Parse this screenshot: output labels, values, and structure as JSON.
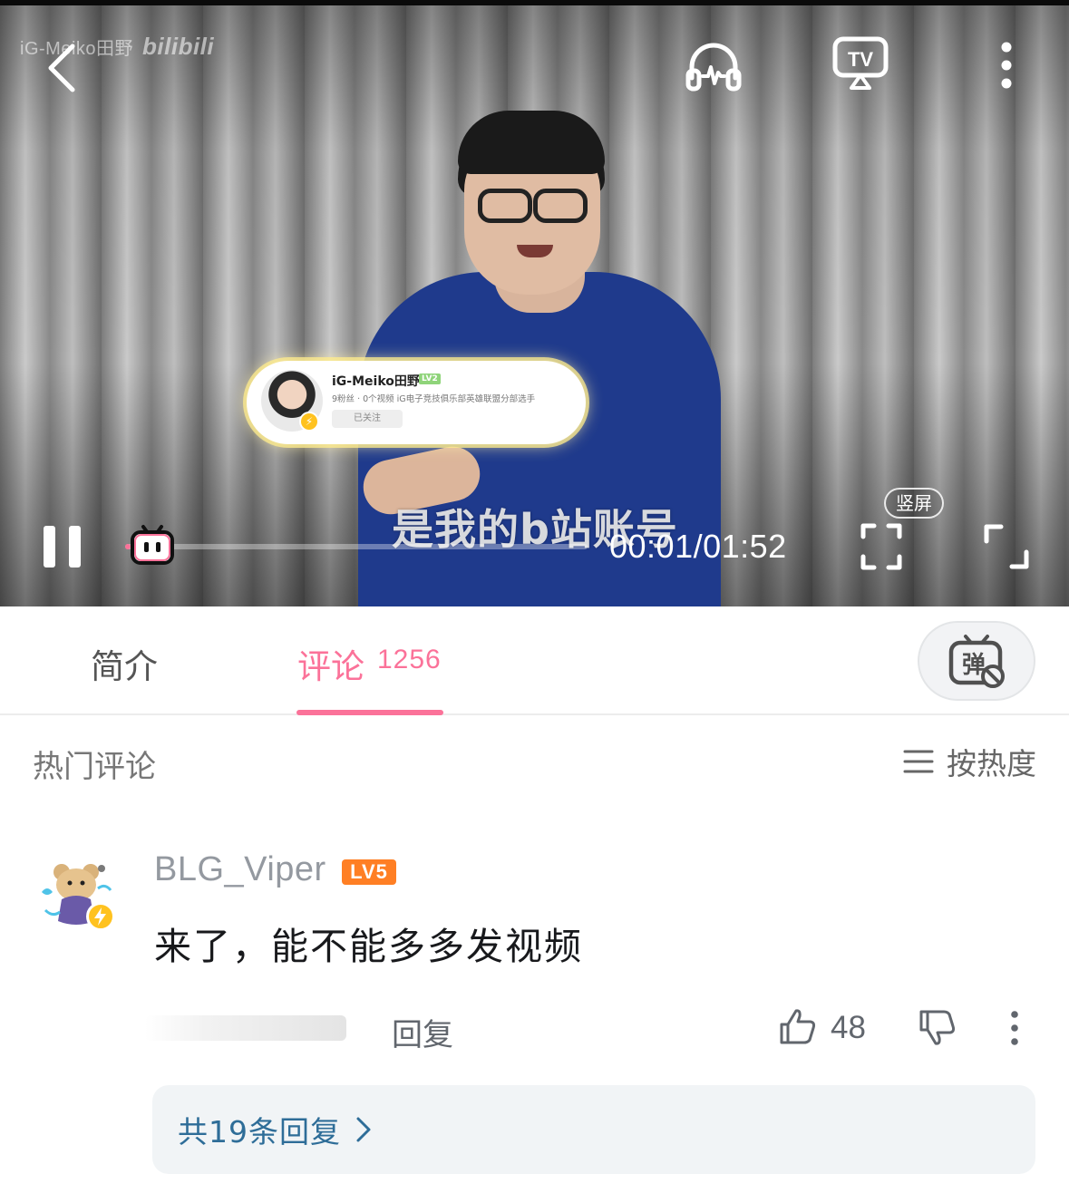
{
  "player": {
    "watermark_channel": "iG-Meiko田野",
    "watermark_brand": "bilibili",
    "subtitle": "是我的b站账号",
    "time_display": "00:01/01:52",
    "portrait_badge": "竖屏",
    "progress_fraction": 0.009,
    "accent_color": "#fb7299",
    "icons": [
      "back-icon",
      "headphones-icon",
      "tv-cast-icon",
      "more-vertical-icon",
      "pause-icon",
      "bilibili-tv-knob-icon",
      "portrait-screen-icon",
      "fullscreen-icon"
    ]
  },
  "profile_card": {
    "name": "iG-Meiko田野",
    "level": "LV2",
    "description": "9粉丝 · 0个视频  iG电子竞技俱乐部英雄联盟分部选手",
    "follow_label": "已关注"
  },
  "tabs": {
    "intro_label": "简介",
    "comments_label": "评论",
    "comments_count": "1256",
    "danmaku_icon": "danmaku-off-icon"
  },
  "comments": {
    "section_title": "热门评论",
    "sort_label": "按热度",
    "items": [
      {
        "username": "BLG_Viper",
        "level": "LV5",
        "text": "来了，能不能多多发视频",
        "reply_label": "回复",
        "likes": "48",
        "replies_link": "共19条回复"
      }
    ]
  }
}
